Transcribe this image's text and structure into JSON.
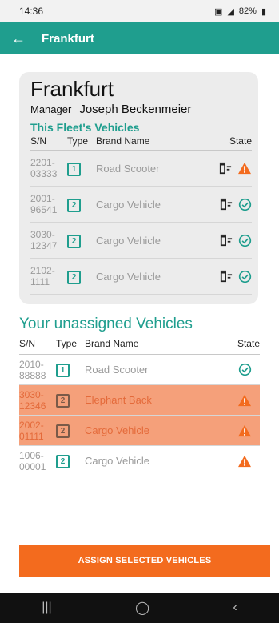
{
  "status_bar": {
    "time": "14:36",
    "battery": "82%"
  },
  "app_bar": {
    "title": "Frankfurt"
  },
  "fleet_card": {
    "title": "Frankfurt",
    "manager_label": "Manager",
    "manager_name": "Joseph Beckenmeier",
    "section_title": "This Fleet's Vehicles",
    "columns": {
      "sn": "S/N",
      "type": "Type",
      "brand": "Brand Name",
      "state": "State"
    },
    "vehicles": [
      {
        "sn": "2201-03333",
        "type": "1",
        "brand": "Road Scooter",
        "state": "warning"
      },
      {
        "sn": "2001-96541",
        "type": "2",
        "brand": "Cargo Vehicle",
        "state": "ok"
      },
      {
        "sn": "3030-12347",
        "type": "2",
        "brand": "Cargo Vehicle",
        "state": "ok"
      },
      {
        "sn": "2102-1111",
        "type": "2",
        "brand": "Cargo Vehicle",
        "state": "ok"
      }
    ]
  },
  "unassigned": {
    "title": "Your unassigned Vehicles",
    "columns": {
      "sn": "S/N",
      "type": "Type",
      "brand": "Brand Name",
      "state": "State"
    },
    "vehicles": [
      {
        "sn": "2010-88888",
        "type": "1",
        "brand": "Road Scooter",
        "state": "ok",
        "selected": false
      },
      {
        "sn": "3030-12346",
        "type": "2",
        "brand": "Elephant Back",
        "state": "warning",
        "selected": true
      },
      {
        "sn": "2002-01111",
        "type": "2",
        "brand": "Cargo Vehicle",
        "state": "warning",
        "selected": true
      },
      {
        "sn": "1006-00001",
        "type": "2",
        "brand": "Cargo Vehicle",
        "state": "warning",
        "selected": false
      }
    ]
  },
  "assign_button": {
    "label": "ASSIGN SELECTED VEHICLES"
  },
  "colors": {
    "accent": "#1f9e8e",
    "action": "#f36b1e",
    "warning": "#f36b1e",
    "selected_row": "#f5a07a"
  }
}
